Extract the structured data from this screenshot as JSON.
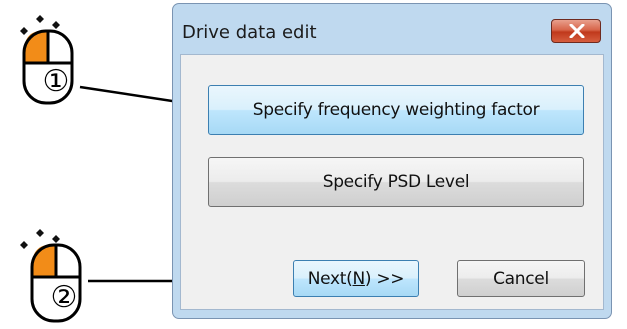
{
  "dialog": {
    "title": "Drive data edit",
    "close_icon": "close-icon"
  },
  "buttons": {
    "frequency_label": "Specify frequency weighting factor",
    "psd_label": "Specify PSD Level",
    "next_prefix": "Next(",
    "next_mnemonic": "N",
    "next_suffix": ") >>",
    "cancel_label": "Cancel"
  },
  "annotations": {
    "step1": "①",
    "step2": "②",
    "mouse_icon": "mouse-left-click-icon",
    "accent_color": "#f28c18"
  }
}
